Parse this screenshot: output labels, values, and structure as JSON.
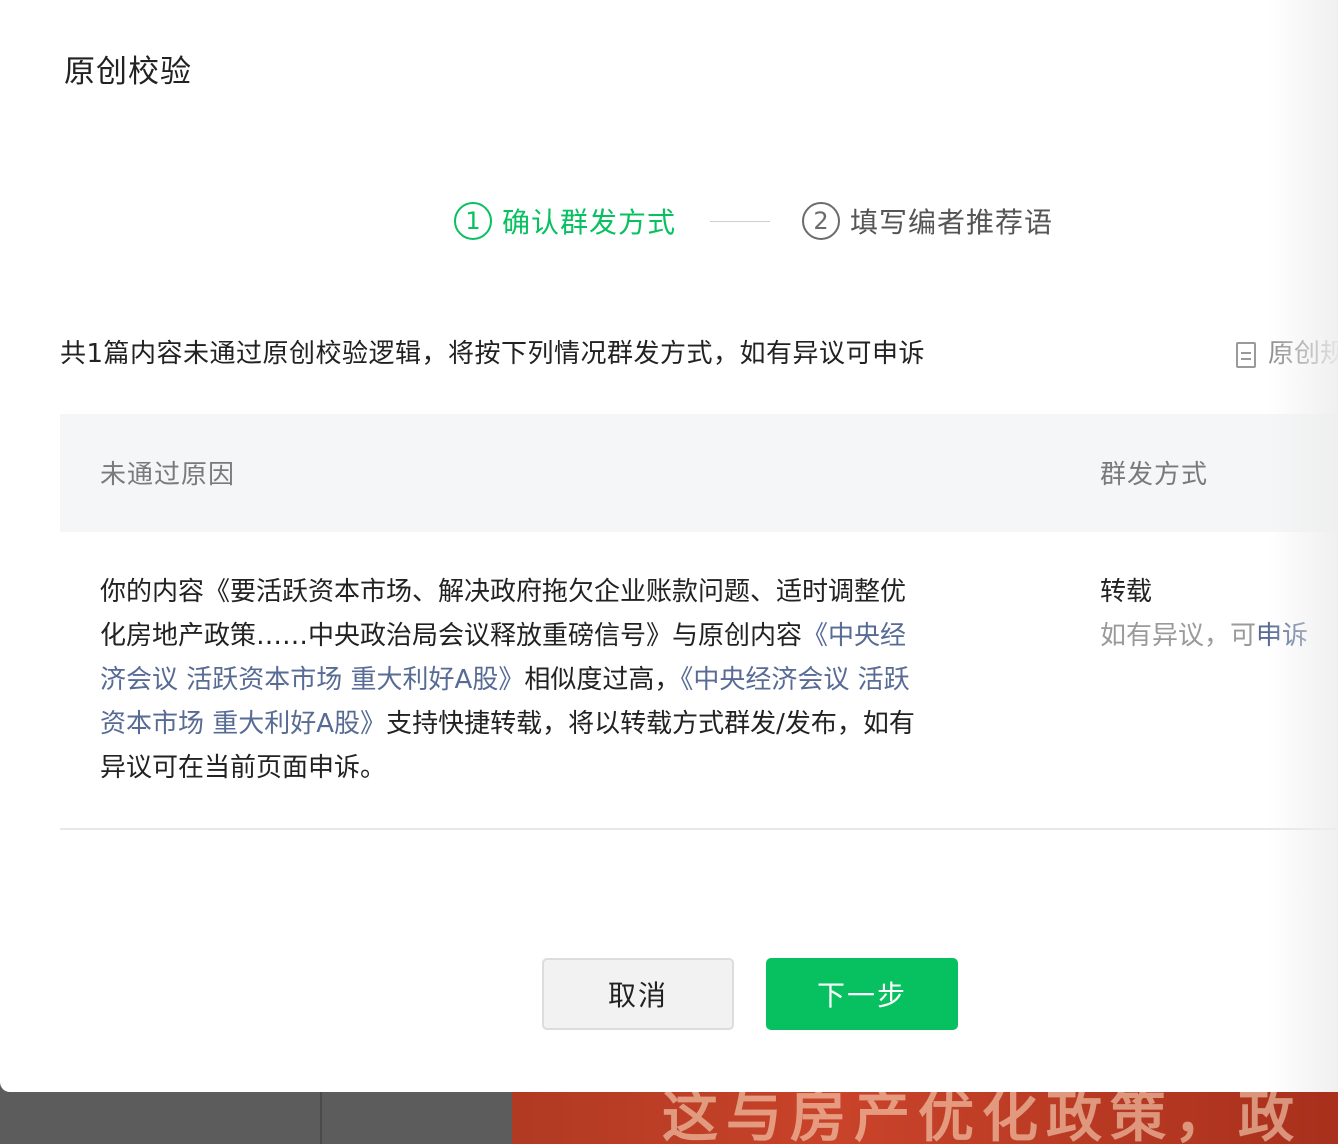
{
  "dialog": {
    "title": "原创校验"
  },
  "steps": [
    {
      "num": "1",
      "label": "确认群发方式",
      "active": true
    },
    {
      "num": "2",
      "label": "填写编者推荐语",
      "active": false
    }
  ],
  "summary": "共1篇内容未通过原创校验逻辑，将按下列情况群发方式，如有异议可申诉",
  "rules_link": "原创规",
  "table": {
    "headers": {
      "reason": "未通过原因",
      "method": "群发方式"
    },
    "row": {
      "reason_parts": {
        "prefix": "你的内容《要活跃资本市场、解决政府拖欠企业账款问题、适时调整优化房地产政策……中央政治局会议释放重磅信号》与原创内容",
        "link1": "《中央经济会议 活跃资本市场 重大利好A股》",
        "middle": "相似度过高，",
        "link2": "《中央经济会议 活跃资本市场 重大利好A股》",
        "suffix": "支持快捷转载，将以转载方式群发/发布，如有异议可在当前页面申诉。"
      },
      "method": "转载",
      "method_note": "如有异议，可",
      "appeal_label": "申诉"
    }
  },
  "buttons": {
    "cancel": "取消",
    "next": "下一步"
  },
  "colors": {
    "accent": "#07c160",
    "link": "#576b95"
  },
  "background": {
    "banner_text": "这与房产优化政策，政"
  }
}
